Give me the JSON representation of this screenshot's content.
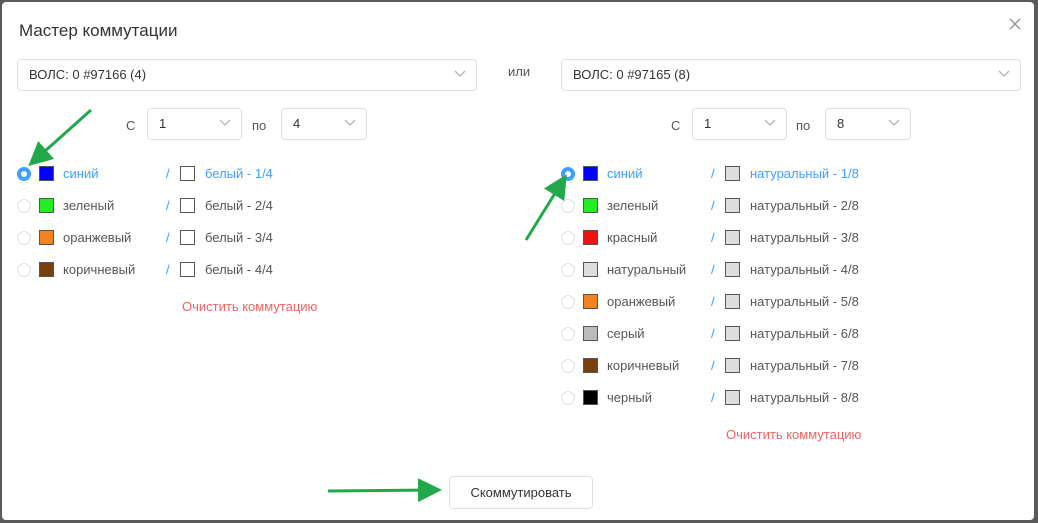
{
  "dialog": {
    "title": "Мастер коммутации",
    "or_label": "или",
    "commit_label": "Скоммутировать"
  },
  "left": {
    "cable": "ВОЛС: 0 #97166 (4)",
    "from_label": "С",
    "from_value": "1",
    "to_label": "по",
    "to_value": "4",
    "clear_label": "Очистить коммутацию",
    "fibers": [
      {
        "module": "синий",
        "module_color": "#0000ff",
        "tube": "белый - 1/4",
        "tube_color": "#ffffff",
        "selected": true
      },
      {
        "module": "зеленый",
        "module_color": "#22ee22",
        "tube": "белый - 2/4",
        "tube_color": "#ffffff",
        "selected": false
      },
      {
        "module": "оранжевый",
        "module_color": "#f58220",
        "tube": "белый - 3/4",
        "tube_color": "#ffffff",
        "selected": false
      },
      {
        "module": "коричневый",
        "module_color": "#7a4010",
        "tube": "белый - 4/4",
        "tube_color": "#ffffff",
        "selected": false
      }
    ]
  },
  "right": {
    "cable": "ВОЛС: 0 #97165 (8)",
    "from_label": "С",
    "from_value": "1",
    "to_label": "по",
    "to_value": "8",
    "clear_label": "Очистить коммутацию",
    "fibers": [
      {
        "module": "синий",
        "module_color": "#0000ff",
        "tube": "натуральный - 1/8",
        "tube_color": "#dddddd",
        "selected": true
      },
      {
        "module": "зеленый",
        "module_color": "#22ee22",
        "tube": "натуральный - 2/8",
        "tube_color": "#dddddd",
        "selected": false
      },
      {
        "module": "красный",
        "module_color": "#ee1111",
        "tube": "натуральный - 3/8",
        "tube_color": "#dddddd",
        "selected": false
      },
      {
        "module": "натуральный",
        "module_color": "#dddddd",
        "tube": "натуральный - 4/8",
        "tube_color": "#dddddd",
        "selected": false
      },
      {
        "module": "оранжевый",
        "module_color": "#f58220",
        "tube": "натуральный - 5/8",
        "tube_color": "#dddddd",
        "selected": false
      },
      {
        "module": "серый",
        "module_color": "#bbbbbb",
        "tube": "натуральный - 6/8",
        "tube_color": "#dddddd",
        "selected": false
      },
      {
        "module": "коричневый",
        "module_color": "#7a4010",
        "tube": "натуральный - 7/8",
        "tube_color": "#dddddd",
        "selected": false
      },
      {
        "module": "черный",
        "module_color": "#000000",
        "tube": "натуральный - 8/8",
        "tube_color": "#dddddd",
        "selected": false
      }
    ]
  },
  "colors": {
    "accent": "#409eff",
    "clear_link": "#e96464",
    "annotation_arrow": "#22a84a"
  }
}
